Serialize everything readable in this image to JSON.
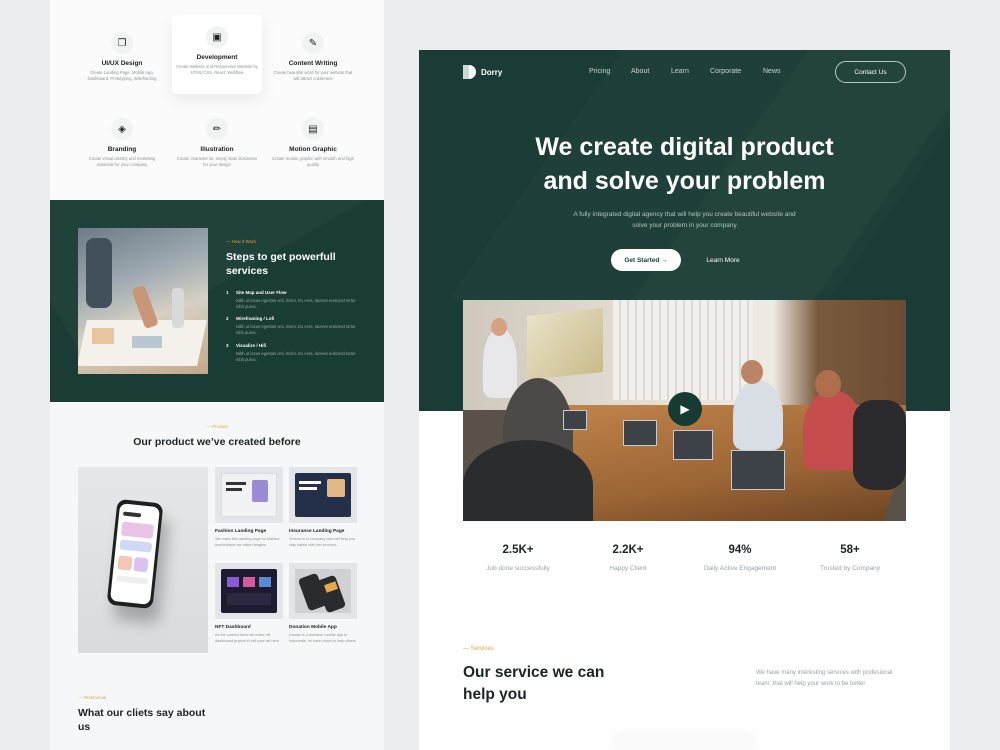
{
  "services_grid": [
    {
      "icon": "ui-ux-icon",
      "glyph": "❐",
      "title": "UI/UX Design",
      "desc": "Create Landing Page, Mobile App, Dashboard, Prototyping, Wireframing"
    },
    {
      "icon": "development-icon",
      "glyph": "▣",
      "title": "Development",
      "desc": "Create Website and Responsive Website by HTML/CSS, React, Webflow"
    },
    {
      "icon": "content-writing-icon",
      "glyph": "✎",
      "title": "Content Writing",
      "desc": "Create beautiful word for your website that will attract customers"
    },
    {
      "icon": "branding-icon",
      "glyph": "◈",
      "title": "Branding",
      "desc": "Create visual identity and marketing materials for your company"
    },
    {
      "icon": "illustration-icon",
      "glyph": "✏",
      "title": "Illustration",
      "desc": "Create character kit, empty state illustration for your design"
    },
    {
      "icon": "motion-graphic-icon",
      "glyph": "▤",
      "title": "Motion Graphic",
      "desc": "Create motion graphic with smooth and high quality"
    }
  ],
  "steps_section": {
    "eyebrow": "— How it Work",
    "title": "Steps to get powerfull services",
    "items": [
      {
        "num": "1",
        "title": "Site Map and User Flow",
        "desc": "Nibh ut lacus egestas orci. Enim. Eu eros, laoreet euismod tortor nibh purus."
      },
      {
        "num": "2",
        "title": "Wireframing / Lofi",
        "desc": "Nibh ut lacus egestas orci. Enim. Eu eros, laoreet euismod tortor nibh purus."
      },
      {
        "num": "3",
        "title": "Visualize / Hifi",
        "desc": "Nibh ut lacus egestas orci. Enim. Eu eros, laoreet euismod tortor nibh purus."
      }
    ]
  },
  "products_section": {
    "eyebrow": "— Product",
    "title": "Our product we’ve created before",
    "cards": [
      {
        "name": "Fashion Landing Page",
        "desc": "We make this landing page for fashion marketplace we called fangies",
        "theme": "#f2f2f5"
      },
      {
        "name": "Insurance Landing Page",
        "desc": "Secure.in is company who will help you stay safety with her services.",
        "theme": "#243049"
      },
      {
        "name": "NFT Dashboard",
        "desc": "As the current trend we make nft dashboard project to sell your art here",
        "theme": "#1f1b2e"
      },
      {
        "name": "Donation Mobile App",
        "desc": "Donasi is a donation mobile app to Indonesia, he have vision to help others",
        "theme": "#cfd1d4"
      }
    ]
  },
  "testimonial_section": {
    "eyebrow": "— Testimonial",
    "title": "What our cliets say about us"
  },
  "header": {
    "logo": "Dorry",
    "nav": [
      "Pricing",
      "About",
      "Learn",
      "Corporate",
      "News"
    ],
    "contact_button": "Contact Us"
  },
  "hero": {
    "heading_line1": "We create digital product",
    "heading_line2": "and solve your problem",
    "subtitle_line1": "A fully integrated digital agency that will help you create beautiful website and",
    "subtitle_line2": "solve your problem in your company",
    "primary_button": "Get Started →",
    "secondary_button": "Learn More"
  },
  "video": {
    "play_icon": "play-icon"
  },
  "stats": [
    {
      "value": "2.5K+",
      "label": "Job  done successfully"
    },
    {
      "value": "2.2K+",
      "label": "Happy Client"
    },
    {
      "value": "94%",
      "label": "Daily Active Engagement"
    },
    {
      "value": "58+",
      "label": "Trusted by Company"
    }
  ],
  "services_section": {
    "eyebrow": "— Services",
    "title_line1": "Our service we can",
    "title_line2": "help you",
    "desc": "We have many interesting services with profesional team, that will help your work to be better"
  },
  "colors": {
    "brand_dark_green": "#1a3c36",
    "accent_orange": "#e6a53a",
    "white": "#ffffff"
  }
}
